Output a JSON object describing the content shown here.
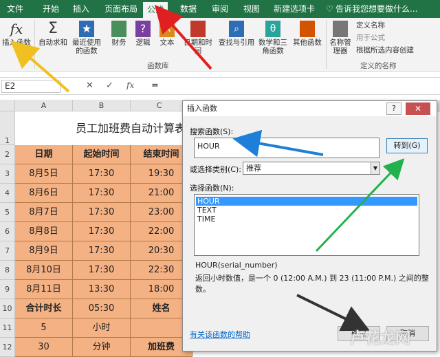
{
  "tabs": [
    "文件",
    "开始",
    "插入",
    "页面布局",
    "公式",
    "数据",
    "审阅",
    "视图",
    "新建选项卡"
  ],
  "tell_me": "告诉我您想要做什么...",
  "ribbon": {
    "insert_function": "插入函数",
    "autosum": "自动求和",
    "recent": "最近使用的函数",
    "financial": "财务",
    "logical": "逻辑",
    "text": "文本",
    "datetime": "日期和时间",
    "lookup": "查找与引用",
    "math": "数学和三角函数",
    "more": "其他函数",
    "name_manager": "名称管理器",
    "define_name": "定义名称",
    "use_in_formula": "用于公式",
    "create_from_sel": "根据所选内容创建",
    "group_library": "函数库",
    "group_names": "定义的名称"
  },
  "formula_bar": {
    "name_box": "E2",
    "fx": "fx",
    "value": "="
  },
  "columns": [
    "A",
    "B",
    "C"
  ],
  "rows": [
    "1",
    "2",
    "3",
    "4",
    "5",
    "6",
    "7",
    "8",
    "9",
    "10",
    "11",
    "12"
  ],
  "sheet": {
    "title": "员工加班费自动计算表",
    "headers": [
      "日期",
      "起始时间",
      "结束时间"
    ],
    "data": [
      [
        "8月5日",
        "17:30",
        "19:30"
      ],
      [
        "8月6日",
        "17:30",
        "21:00"
      ],
      [
        "8月7日",
        "17:30",
        "23:00"
      ],
      [
        "8月8日",
        "17:30",
        "22:00"
      ],
      [
        "8月9日",
        "17:30",
        "20:30"
      ],
      [
        "8月10日",
        "17:30",
        "22:30"
      ],
      [
        "8月11日",
        "13:30",
        "18:00"
      ]
    ],
    "total_label": "合计时长",
    "total_value": "05:30",
    "name_label": "姓名",
    "hours_value": "5",
    "hours_unit": "小时",
    "minutes_value": "30",
    "minutes_unit": "分钟",
    "pay_label": "加班费"
  },
  "dialog": {
    "title": "插入函数",
    "help": "?",
    "close": "✕",
    "search_label": "搜索函数(S):",
    "search_value": "HOUR",
    "goto": "转到(G)",
    "category_label": "或选择类别(C):",
    "category_value": "推荐",
    "list_label": "选择函数(N):",
    "functions": [
      "HOUR",
      "TEXT",
      "TIME"
    ],
    "signature": "HOUR(serial_number)",
    "description": "返回小时数值，是一个 0 (12:00 A.M.) 到 23 (11:00 P.M.) 之间的整数。",
    "help_link": "有关该函数的帮助",
    "ok": "确定",
    "cancel": "取消"
  },
  "watermark": "卢花龙网"
}
